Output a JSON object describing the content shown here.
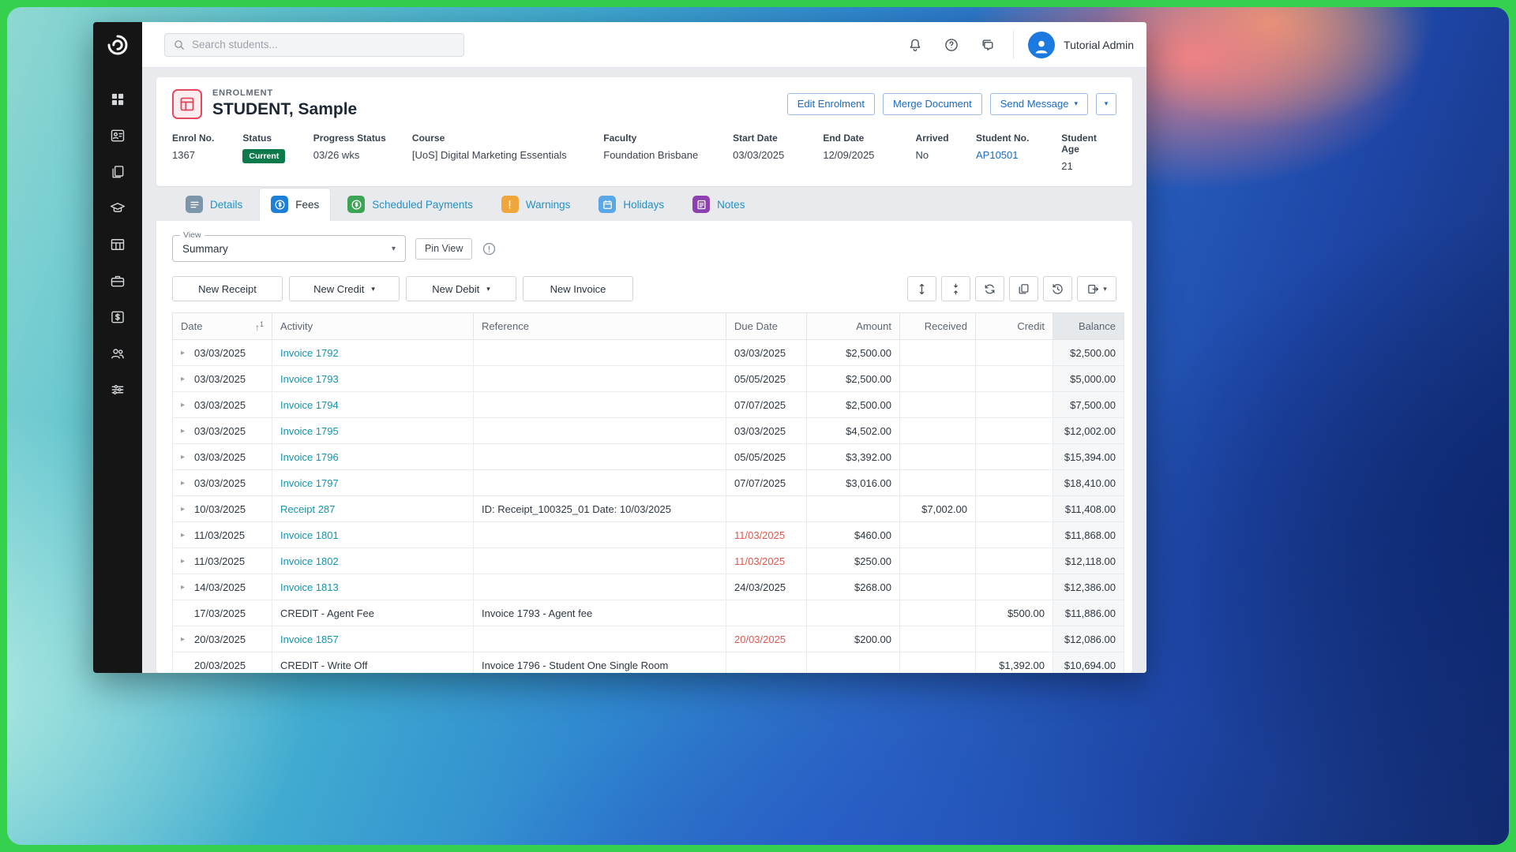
{
  "colors": {
    "frame_green": "#35d04e",
    "accent_blue": "#1a6bc4",
    "link_teal": "#1794ad",
    "badge_green": "#0c7a4a",
    "overdue_red": "#df5850",
    "sidebar_bg": "#151515"
  },
  "sidebar": {
    "items": [
      {
        "name": "dashboard",
        "icon": "dashboard-icon"
      },
      {
        "name": "contacts",
        "icon": "contacts-icon"
      },
      {
        "name": "documents",
        "icon": "documents-icon"
      },
      {
        "name": "academics",
        "icon": "academics-icon"
      },
      {
        "name": "classes",
        "icon": "classes-icon"
      },
      {
        "name": "work-placement",
        "icon": "briefcase-icon"
      },
      {
        "name": "finance",
        "icon": "finance-icon"
      },
      {
        "name": "agents",
        "icon": "agents-icon"
      },
      {
        "name": "settings",
        "icon": "sliders-icon"
      }
    ]
  },
  "topbar": {
    "search_placeholder": "Search students...",
    "icons": [
      "notifications-icon",
      "help-icon",
      "messages-icon"
    ],
    "user_name": "Tutorial Admin"
  },
  "enrolment": {
    "eyebrow": "ENROLMENT",
    "title": "STUDENT, Sample",
    "actions": {
      "edit": "Edit Enrolment",
      "merge": "Merge Document",
      "send": "Send Message"
    },
    "info": [
      {
        "label": "Enrol No.",
        "value": "1367",
        "badge": false,
        "link": false
      },
      {
        "label": "Status",
        "value": "Current",
        "badge": true,
        "link": false
      },
      {
        "label": "Progress Status",
        "value": "03/26 wks",
        "badge": false,
        "link": false
      },
      {
        "label": "Course",
        "value": "[UoS] Digital Marketing Essentials",
        "badge": false,
        "link": false
      },
      {
        "label": "Faculty",
        "value": "Foundation Brisbane",
        "badge": false,
        "link": false
      },
      {
        "label": "Start Date",
        "value": "03/03/2025",
        "badge": false,
        "link": false
      },
      {
        "label": "End Date",
        "value": "12/09/2025",
        "badge": false,
        "link": false
      },
      {
        "label": "Arrived",
        "value": "No",
        "badge": false,
        "link": false
      },
      {
        "label": "Student No.",
        "value": "AP10501",
        "badge": false,
        "link": true
      },
      {
        "label": "Student Age",
        "value": "21",
        "badge": false,
        "link": false
      }
    ]
  },
  "tabs": [
    {
      "label": "Details",
      "icon": "details-icon",
      "color": "#7d95a9",
      "active": false
    },
    {
      "label": "Fees",
      "icon": "fees-icon",
      "color": "#1d7fd6",
      "active": true
    },
    {
      "label": "Scheduled Payments",
      "icon": "scheduled-payments-icon",
      "color": "#3ba553",
      "active": false
    },
    {
      "label": "Warnings",
      "icon": "warnings-icon",
      "color": "#f0a63a",
      "active": false
    },
    {
      "label": "Holidays",
      "icon": "holidays-icon",
      "color": "#5aa7e8",
      "active": false
    },
    {
      "label": "Notes",
      "icon": "notes-icon",
      "color": "#8e3fb0",
      "active": false
    }
  ],
  "fees_toolbar": {
    "view_label": "View",
    "view_value": "Summary",
    "pin_view_label": "Pin View",
    "new_buttons": [
      {
        "label": "New Receipt",
        "caret": false
      },
      {
        "label": "New Credit",
        "caret": true
      },
      {
        "label": "New Debit",
        "caret": true
      },
      {
        "label": "New Invoice",
        "caret": false
      }
    ],
    "icon_buttons": [
      "expand-rows-icon",
      "collapse-rows-icon",
      "refresh-icon",
      "duplicate-icon",
      "history-icon",
      "export-icon"
    ]
  },
  "fees_table": {
    "columns": [
      {
        "label": "Date",
        "align": "left",
        "shaded": false,
        "sort": "1"
      },
      {
        "label": "Activity",
        "align": "left",
        "shaded": false,
        "sort": ""
      },
      {
        "label": "Reference",
        "align": "left",
        "shaded": false,
        "sort": ""
      },
      {
        "label": "Due Date",
        "align": "left",
        "shaded": false,
        "sort": ""
      },
      {
        "label": "Amount",
        "align": "right",
        "shaded": false,
        "sort": ""
      },
      {
        "label": "Received",
        "align": "right",
        "shaded": false,
        "sort": ""
      },
      {
        "label": "Credit",
        "align": "right",
        "shaded": false,
        "sort": ""
      },
      {
        "label": "Balance",
        "align": "right",
        "shaded": true,
        "sort": ""
      }
    ],
    "rows": [
      {
        "expandable": true,
        "date": "03/03/2025",
        "activity": "Invoice 1792",
        "activity_link": true,
        "reference": "",
        "due_date": "03/03/2025",
        "overdue": false,
        "amount": "$2,500.00",
        "received": "",
        "credit": "",
        "balance": "$2,500.00"
      },
      {
        "expandable": true,
        "date": "03/03/2025",
        "activity": "Invoice 1793",
        "activity_link": true,
        "reference": "",
        "due_date": "05/05/2025",
        "overdue": false,
        "amount": "$2,500.00",
        "received": "",
        "credit": "",
        "balance": "$5,000.00"
      },
      {
        "expandable": true,
        "date": "03/03/2025",
        "activity": "Invoice 1794",
        "activity_link": true,
        "reference": "",
        "due_date": "07/07/2025",
        "overdue": false,
        "amount": "$2,500.00",
        "received": "",
        "credit": "",
        "balance": "$7,500.00"
      },
      {
        "expandable": true,
        "date": "03/03/2025",
        "activity": "Invoice 1795",
        "activity_link": true,
        "reference": "",
        "due_date": "03/03/2025",
        "overdue": false,
        "amount": "$4,502.00",
        "received": "",
        "credit": "",
        "balance": "$12,002.00"
      },
      {
        "expandable": true,
        "date": "03/03/2025",
        "activity": "Invoice 1796",
        "activity_link": true,
        "reference": "",
        "due_date": "05/05/2025",
        "overdue": false,
        "amount": "$3,392.00",
        "received": "",
        "credit": "",
        "balance": "$15,394.00"
      },
      {
        "expandable": true,
        "date": "03/03/2025",
        "activity": "Invoice 1797",
        "activity_link": true,
        "reference": "",
        "due_date": "07/07/2025",
        "overdue": false,
        "amount": "$3,016.00",
        "received": "",
        "credit": "",
        "balance": "$18,410.00"
      },
      {
        "expandable": true,
        "date": "10/03/2025",
        "activity": "Receipt 287",
        "activity_link": true,
        "reference": "ID: Receipt_100325_01 Date: 10/03/2025",
        "due_date": "",
        "overdue": false,
        "amount": "",
        "received": "$7,002.00",
        "credit": "",
        "balance": "$11,408.00"
      },
      {
        "expandable": true,
        "date": "11/03/2025",
        "activity": "Invoice 1801",
        "activity_link": true,
        "reference": "",
        "due_date": "11/03/2025",
        "overdue": true,
        "amount": "$460.00",
        "received": "",
        "credit": "",
        "balance": "$11,868.00"
      },
      {
        "expandable": true,
        "date": "11/03/2025",
        "activity": "Invoice 1802",
        "activity_link": true,
        "reference": "",
        "due_date": "11/03/2025",
        "overdue": true,
        "amount": "$250.00",
        "received": "",
        "credit": "",
        "balance": "$12,118.00"
      },
      {
        "expandable": true,
        "date": "14/03/2025",
        "activity": "Invoice 1813",
        "activity_link": true,
        "reference": "",
        "due_date": "24/03/2025",
        "overdue": false,
        "amount": "$268.00",
        "received": "",
        "credit": "",
        "balance": "$12,386.00"
      },
      {
        "expandable": false,
        "date": "17/03/2025",
        "activity": "CREDIT - Agent Fee",
        "activity_link": false,
        "reference": "Invoice 1793 - Agent fee",
        "due_date": "",
        "overdue": false,
        "amount": "",
        "received": "",
        "credit": "$500.00",
        "balance": "$11,886.00"
      },
      {
        "expandable": true,
        "date": "20/03/2025",
        "activity": "Invoice 1857",
        "activity_link": true,
        "reference": "",
        "due_date": "20/03/2025",
        "overdue": true,
        "amount": "$200.00",
        "received": "",
        "credit": "",
        "balance": "$12,086.00"
      },
      {
        "expandable": false,
        "date": "20/03/2025",
        "activity": "CREDIT - Write Off",
        "activity_link": false,
        "reference": "Invoice 1796 - Student One Single Room",
        "due_date": "",
        "overdue": false,
        "amount": "",
        "received": "",
        "credit": "$1,392.00",
        "balance": "$10,694.00"
      }
    ]
  }
}
